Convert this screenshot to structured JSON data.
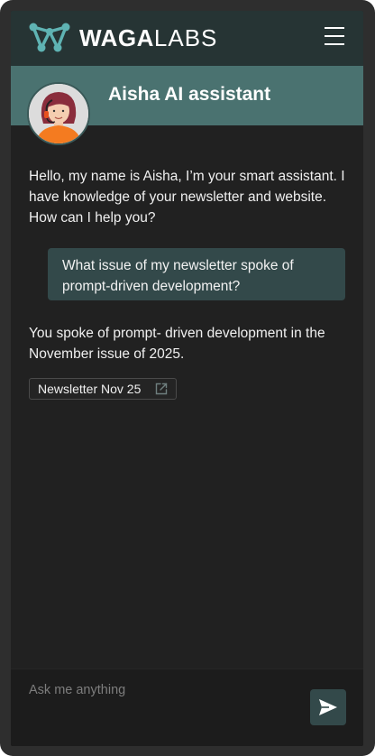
{
  "brand": {
    "name_bold": "WAGA",
    "name_light": "LABS"
  },
  "assistant": {
    "title": "Aisha AI assistant"
  },
  "messages": {
    "greeting": "Hello, my name is Aisha, I’m your smart assistant. I have knowledge of your newsletter and website. How can I help you?",
    "user_question": "What issue of my newsletter spoke of prompt-driven development?",
    "bot_answer": "You spoke of prompt- driven development in the November issue of 2025.",
    "source_label": "Newsletter Nov 25"
  },
  "input": {
    "placeholder": "Ask me anything"
  },
  "icons": {
    "logo": "waga-network-logo-icon",
    "menu": "hamburger-menu-icon",
    "external_link": "external-link-icon",
    "send": "send-icon"
  },
  "colors": {
    "header": "#263434",
    "assistant_bar": "#4a7270",
    "user_bubble": "#33494a",
    "background": "#212121",
    "logo_accent": "#5fb3b3",
    "avatar_shirt": "#f47b20"
  }
}
